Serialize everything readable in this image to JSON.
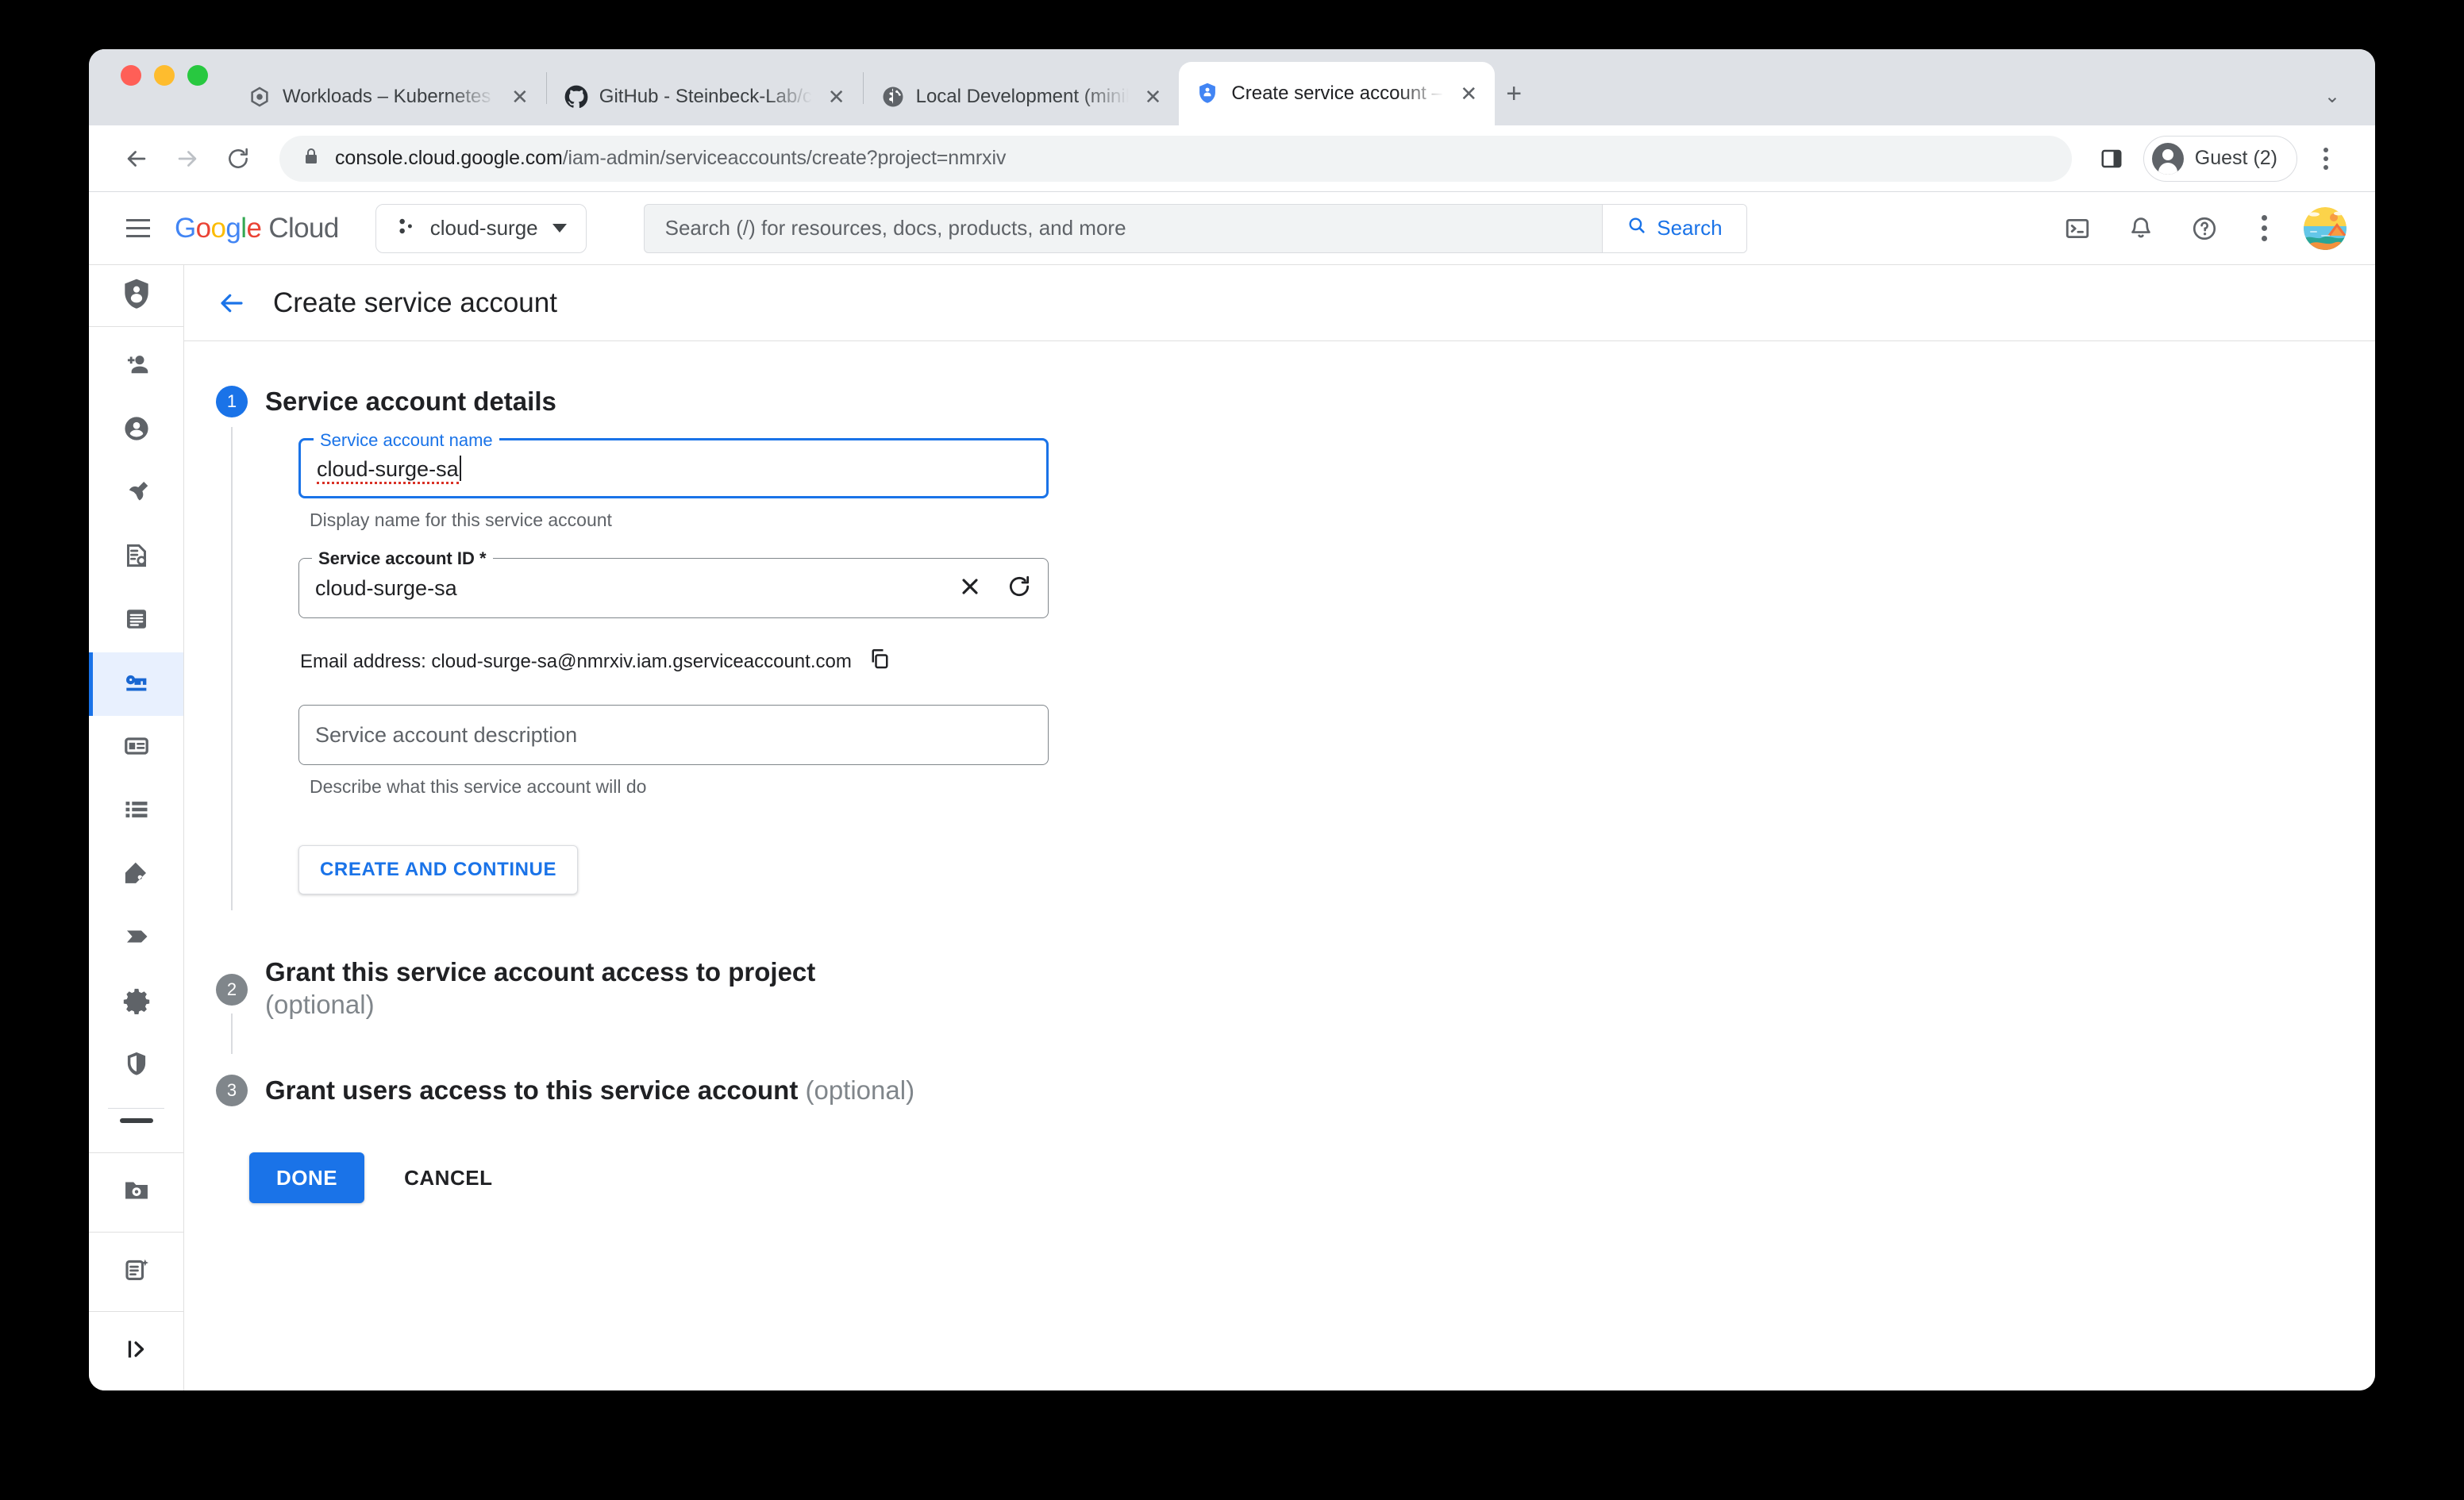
{
  "browser": {
    "tabs": [
      {
        "title": "Workloads – Kubernetes Engine",
        "favicon": "gke-icon",
        "active": false
      },
      {
        "title": "GitHub - Steinbeck-Lab/cloud",
        "favicon": "github-icon",
        "active": false
      },
      {
        "title": "Local Development (minikube)",
        "favicon": "globe-icon",
        "active": false
      },
      {
        "title": "Create service account – IAM &",
        "favicon": "iam-shield-icon",
        "active": true
      }
    ],
    "new_tab_label": "+",
    "tab_list_chevron": "⌄",
    "close_label": "✕",
    "url_domain": "console.cloud.google.com",
    "url_path": "/iam-admin/serviceaccounts/create?project=nmrxiv",
    "profile_label": "Guest (2)"
  },
  "gc_header": {
    "logo_google": "Google",
    "logo_cloud": "Cloud",
    "logo_letters": [
      {
        "ch": "G",
        "color": "#4285f4"
      },
      {
        "ch": "o",
        "color": "#ea4335"
      },
      {
        "ch": "o",
        "color": "#fbbc05"
      },
      {
        "ch": "g",
        "color": "#4285f4"
      },
      {
        "ch": "l",
        "color": "#34a853"
      },
      {
        "ch": "e",
        "color": "#ea4335"
      }
    ],
    "project_name": "cloud-surge",
    "search_placeholder": "Search (/) for resources, docs, products, and more",
    "search_button": "Search"
  },
  "sidebar": {
    "header_icon": "iam-shield-person-icon",
    "items": [
      {
        "icon": "person-add-icon",
        "active": false
      },
      {
        "icon": "person-circle-icon",
        "active": false
      },
      {
        "icon": "wrench-icon",
        "active": false
      },
      {
        "icon": "policy-document-icon",
        "active": false
      },
      {
        "icon": "article-icon",
        "active": false
      },
      {
        "icon": "key-service-account-icon",
        "active": true
      },
      {
        "icon": "badge-id-card-icon",
        "active": false
      },
      {
        "icon": "list-icon",
        "active": false
      },
      {
        "icon": "label-tag-icon",
        "active": false
      },
      {
        "icon": "banner-chevron-icon",
        "active": false
      },
      {
        "icon": "gear-icon",
        "active": false
      },
      {
        "icon": "shield-security-icon",
        "active": false
      }
    ],
    "bottom_items": [
      {
        "icon": "folder-settings-icon"
      },
      {
        "icon": "release-notes-icon"
      },
      {
        "icon": "expand-panel-icon"
      }
    ]
  },
  "page": {
    "back_icon": "back-arrow-icon",
    "title": "Create service account"
  },
  "steps": [
    {
      "number": "1",
      "title": "Service account details",
      "optional": "",
      "state": "active"
    },
    {
      "number": "2",
      "title": "Grant this service account access to project",
      "optional": "(optional)",
      "state": "pending"
    },
    {
      "number": "3",
      "title": "Grant users access to this service account",
      "optional": "(optional)",
      "state": "pending"
    }
  ],
  "form": {
    "name_label": "Service account name",
    "name_value": "cloud-surge-sa",
    "name_hint": "Display name for this service account",
    "id_label": "Service account ID *",
    "id_value": "cloud-surge-sa",
    "id_clear_icon": "clear-x-icon",
    "id_refresh_icon": "refresh-icon",
    "email_text": "Email address: cloud-surge-sa@nmrxiv.iam.gserviceaccount.com",
    "email_copy_icon": "copy-icon",
    "description_placeholder": "Service account description",
    "description_hint": "Describe what this service account will do",
    "create_continue_label": "CREATE AND CONTINUE"
  },
  "footer": {
    "done_label": "DONE",
    "cancel_label": "CANCEL"
  },
  "colors": {
    "accent_blue": "#1a73e8",
    "active_rail_bg": "#e8f0fe",
    "tab_strip": "#dee1e6",
    "spellcheck_red": "#d93025"
  }
}
